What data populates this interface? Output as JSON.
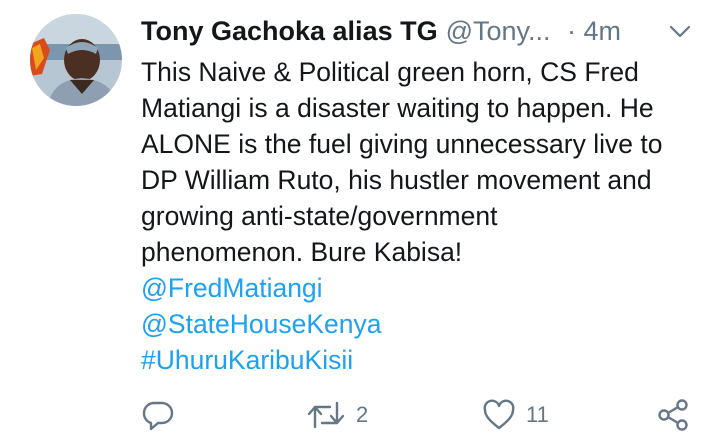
{
  "tweet": {
    "author_name": "Tony Gachoka alias TG",
    "handle": "@Tony...",
    "time": "· 4m",
    "body_lines": [
      "This Naive & Political green horn, CS Fred",
      "Matiangi is a disaster waiting to happen. He",
      "ALONE is the fuel giving unnecessary live to",
      "DP William Ruto, his hustler movement and",
      "growing anti-state/government",
      "phenomenon. Bure Kabisa!"
    ],
    "mentions": [
      "@FredMatiangi",
      "@StateHouseKenya",
      "#UhuruKaribuKisii"
    ]
  },
  "actions": {
    "reply_icon": "reply-icon",
    "retweet_icon": "retweet-icon",
    "retweet_count": "2",
    "like_icon": "heart-icon",
    "like_count": "11",
    "share_icon": "share-icon"
  },
  "colors": {
    "text": "#14171a",
    "secondary": "#657786",
    "link": "#1da1f2"
  }
}
